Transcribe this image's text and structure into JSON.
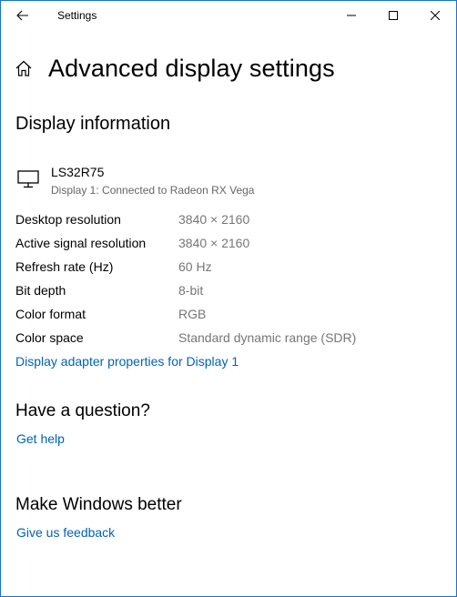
{
  "window": {
    "title": "Settings"
  },
  "header": {
    "page_title": "Advanced display settings"
  },
  "display_info": {
    "heading": "Display information",
    "monitor_name": "LS32R75",
    "monitor_sub": "Display 1: Connected to Radeon RX Vega",
    "rows": [
      {
        "label": "Desktop resolution",
        "value": "3840 × 2160"
      },
      {
        "label": "Active signal resolution",
        "value": "3840 × 2160"
      },
      {
        "label": "Refresh rate (Hz)",
        "value": "60 Hz"
      },
      {
        "label": "Bit depth",
        "value": "8-bit"
      },
      {
        "label": "Color format",
        "value": "RGB"
      },
      {
        "label": "Color space",
        "value": "Standard dynamic range (SDR)"
      }
    ],
    "adapter_link": "Display adapter properties for Display 1"
  },
  "question": {
    "heading": "Have a question?",
    "link": "Get help"
  },
  "feedback": {
    "heading": "Make Windows better",
    "link": "Give us feedback"
  },
  "colors": {
    "accent": "#0063b1",
    "window_border": "#1a73c9",
    "secondary_text": "#767676"
  },
  "icons": {
    "back": "back-arrow-icon",
    "minimize": "minimize-icon",
    "maximize": "maximize-icon",
    "close": "close-icon",
    "home": "home-icon",
    "monitor": "monitor-icon"
  }
}
